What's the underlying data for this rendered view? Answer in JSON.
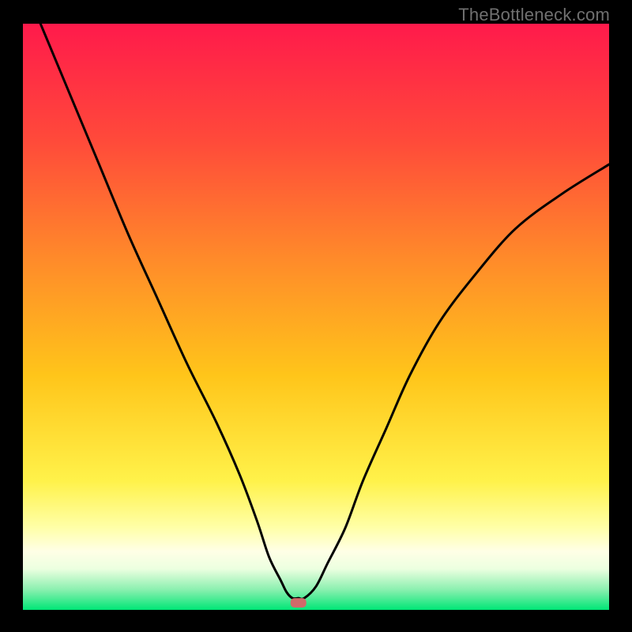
{
  "watermark": "TheBottleneck.com",
  "chart_data": {
    "type": "line",
    "title": "",
    "xlabel": "",
    "ylabel": "",
    "xlim": [
      0,
      100
    ],
    "ylim": [
      0,
      100
    ],
    "grid": false,
    "legend": false,
    "series": [
      {
        "name": "curve",
        "x": [
          3,
          8,
          13,
          18,
          23,
          28,
          33,
          37,
          40,
          42,
          44,
          45,
          46,
          47,
          48,
          50,
          52,
          55,
          58,
          62,
          66,
          71,
          77,
          84,
          92,
          100
        ],
        "y": [
          100,
          88,
          76,
          64,
          53,
          42,
          32,
          23,
          15,
          9,
          5,
          3,
          2,
          2,
          2,
          4,
          8,
          14,
          22,
          31,
          40,
          49,
          57,
          65,
          71,
          76
        ]
      }
    ],
    "marker": {
      "x": 47,
      "y": 1.2,
      "color": "#d06a6a"
    },
    "background_gradient": {
      "stops": [
        {
          "offset": 0,
          "color": "#ff1a4b"
        },
        {
          "offset": 0.2,
          "color": "#ff4a3a"
        },
        {
          "offset": 0.4,
          "color": "#ff8a2a"
        },
        {
          "offset": 0.6,
          "color": "#ffc51a"
        },
        {
          "offset": 0.78,
          "color": "#fff24a"
        },
        {
          "offset": 0.86,
          "color": "#ffffa8"
        },
        {
          "offset": 0.9,
          "color": "#ffffe6"
        },
        {
          "offset": 0.93,
          "color": "#ecffe0"
        },
        {
          "offset": 0.965,
          "color": "#8cf0b0"
        },
        {
          "offset": 1.0,
          "color": "#00e676"
        }
      ]
    }
  }
}
